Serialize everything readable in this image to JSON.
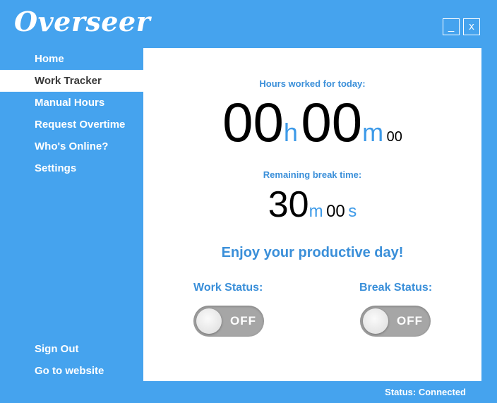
{
  "app": {
    "title": "Overseer"
  },
  "window_controls": {
    "minimize": "_",
    "close": "x"
  },
  "nav": {
    "items": [
      {
        "label": "Home",
        "active": false
      },
      {
        "label": "Work Tracker",
        "active": true
      },
      {
        "label": "Manual Hours",
        "active": false
      },
      {
        "label": "Request Overtime",
        "active": false
      },
      {
        "label": "Who's Online?",
        "active": false
      },
      {
        "label": "Settings",
        "active": false
      }
    ],
    "bottom": [
      {
        "label": "Sign Out"
      },
      {
        "label": "Go to website"
      }
    ]
  },
  "tracker": {
    "hours_label": "Hours worked for today:",
    "hours": "00",
    "hours_unit": "h",
    "minutes": "00",
    "minutes_unit": "m",
    "seconds": "00",
    "break_label": "Remaining break time:",
    "break_minutes": "30",
    "break_minutes_unit": "m",
    "break_seconds": "00",
    "break_seconds_unit": "s",
    "motto": "Enjoy your productive day!"
  },
  "work_status": {
    "label": "Work Status:",
    "toggle": "OFF"
  },
  "break_status": {
    "label": "Break Status:",
    "toggle": "OFF"
  },
  "statusbar": {
    "text": "Status: Connected"
  },
  "colors": {
    "background": "#45a3ee",
    "accent": "#3a8fd9",
    "toggle_off": "#a6a6a6"
  }
}
